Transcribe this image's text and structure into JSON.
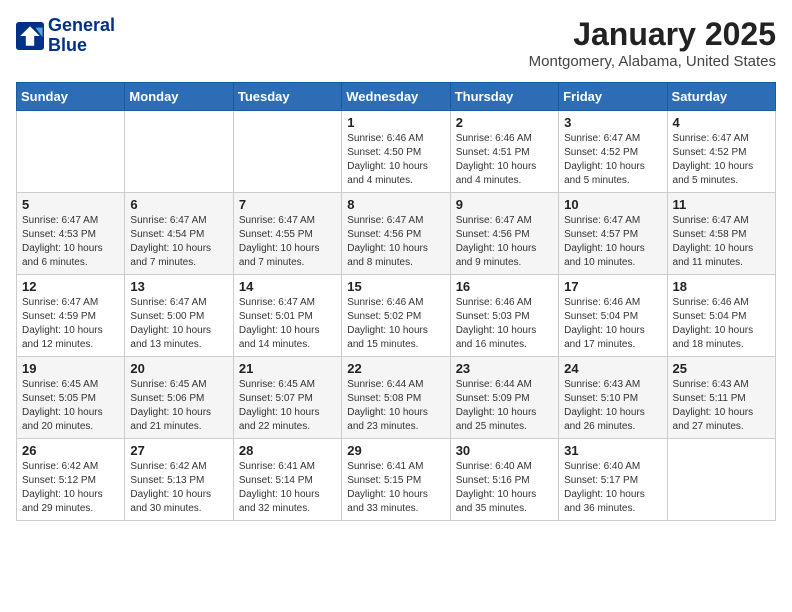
{
  "header": {
    "logo_line1": "General",
    "logo_line2": "Blue",
    "month": "January 2025",
    "location": "Montgomery, Alabama, United States"
  },
  "weekdays": [
    "Sunday",
    "Monday",
    "Tuesday",
    "Wednesday",
    "Thursday",
    "Friday",
    "Saturday"
  ],
  "weeks": [
    [
      {
        "day": "",
        "info": ""
      },
      {
        "day": "",
        "info": ""
      },
      {
        "day": "",
        "info": ""
      },
      {
        "day": "1",
        "info": "Sunrise: 6:46 AM\nSunset: 4:50 PM\nDaylight: 10 hours\nand 4 minutes."
      },
      {
        "day": "2",
        "info": "Sunrise: 6:46 AM\nSunset: 4:51 PM\nDaylight: 10 hours\nand 4 minutes."
      },
      {
        "day": "3",
        "info": "Sunrise: 6:47 AM\nSunset: 4:52 PM\nDaylight: 10 hours\nand 5 minutes."
      },
      {
        "day": "4",
        "info": "Sunrise: 6:47 AM\nSunset: 4:52 PM\nDaylight: 10 hours\nand 5 minutes."
      }
    ],
    [
      {
        "day": "5",
        "info": "Sunrise: 6:47 AM\nSunset: 4:53 PM\nDaylight: 10 hours\nand 6 minutes."
      },
      {
        "day": "6",
        "info": "Sunrise: 6:47 AM\nSunset: 4:54 PM\nDaylight: 10 hours\nand 7 minutes."
      },
      {
        "day": "7",
        "info": "Sunrise: 6:47 AM\nSunset: 4:55 PM\nDaylight: 10 hours\nand 7 minutes."
      },
      {
        "day": "8",
        "info": "Sunrise: 6:47 AM\nSunset: 4:56 PM\nDaylight: 10 hours\nand 8 minutes."
      },
      {
        "day": "9",
        "info": "Sunrise: 6:47 AM\nSunset: 4:56 PM\nDaylight: 10 hours\nand 9 minutes."
      },
      {
        "day": "10",
        "info": "Sunrise: 6:47 AM\nSunset: 4:57 PM\nDaylight: 10 hours\nand 10 minutes."
      },
      {
        "day": "11",
        "info": "Sunrise: 6:47 AM\nSunset: 4:58 PM\nDaylight: 10 hours\nand 11 minutes."
      }
    ],
    [
      {
        "day": "12",
        "info": "Sunrise: 6:47 AM\nSunset: 4:59 PM\nDaylight: 10 hours\nand 12 minutes."
      },
      {
        "day": "13",
        "info": "Sunrise: 6:47 AM\nSunset: 5:00 PM\nDaylight: 10 hours\nand 13 minutes."
      },
      {
        "day": "14",
        "info": "Sunrise: 6:47 AM\nSunset: 5:01 PM\nDaylight: 10 hours\nand 14 minutes."
      },
      {
        "day": "15",
        "info": "Sunrise: 6:46 AM\nSunset: 5:02 PM\nDaylight: 10 hours\nand 15 minutes."
      },
      {
        "day": "16",
        "info": "Sunrise: 6:46 AM\nSunset: 5:03 PM\nDaylight: 10 hours\nand 16 minutes."
      },
      {
        "day": "17",
        "info": "Sunrise: 6:46 AM\nSunset: 5:04 PM\nDaylight: 10 hours\nand 17 minutes."
      },
      {
        "day": "18",
        "info": "Sunrise: 6:46 AM\nSunset: 5:04 PM\nDaylight: 10 hours\nand 18 minutes."
      }
    ],
    [
      {
        "day": "19",
        "info": "Sunrise: 6:45 AM\nSunset: 5:05 PM\nDaylight: 10 hours\nand 20 minutes."
      },
      {
        "day": "20",
        "info": "Sunrise: 6:45 AM\nSunset: 5:06 PM\nDaylight: 10 hours\nand 21 minutes."
      },
      {
        "day": "21",
        "info": "Sunrise: 6:45 AM\nSunset: 5:07 PM\nDaylight: 10 hours\nand 22 minutes."
      },
      {
        "day": "22",
        "info": "Sunrise: 6:44 AM\nSunset: 5:08 PM\nDaylight: 10 hours\nand 23 minutes."
      },
      {
        "day": "23",
        "info": "Sunrise: 6:44 AM\nSunset: 5:09 PM\nDaylight: 10 hours\nand 25 minutes."
      },
      {
        "day": "24",
        "info": "Sunrise: 6:43 AM\nSunset: 5:10 PM\nDaylight: 10 hours\nand 26 minutes."
      },
      {
        "day": "25",
        "info": "Sunrise: 6:43 AM\nSunset: 5:11 PM\nDaylight: 10 hours\nand 27 minutes."
      }
    ],
    [
      {
        "day": "26",
        "info": "Sunrise: 6:42 AM\nSunset: 5:12 PM\nDaylight: 10 hours\nand 29 minutes."
      },
      {
        "day": "27",
        "info": "Sunrise: 6:42 AM\nSunset: 5:13 PM\nDaylight: 10 hours\nand 30 minutes."
      },
      {
        "day": "28",
        "info": "Sunrise: 6:41 AM\nSunset: 5:14 PM\nDaylight: 10 hours\nand 32 minutes."
      },
      {
        "day": "29",
        "info": "Sunrise: 6:41 AM\nSunset: 5:15 PM\nDaylight: 10 hours\nand 33 minutes."
      },
      {
        "day": "30",
        "info": "Sunrise: 6:40 AM\nSunset: 5:16 PM\nDaylight: 10 hours\nand 35 minutes."
      },
      {
        "day": "31",
        "info": "Sunrise: 6:40 AM\nSunset: 5:17 PM\nDaylight: 10 hours\nand 36 minutes."
      },
      {
        "day": "",
        "info": ""
      }
    ]
  ]
}
